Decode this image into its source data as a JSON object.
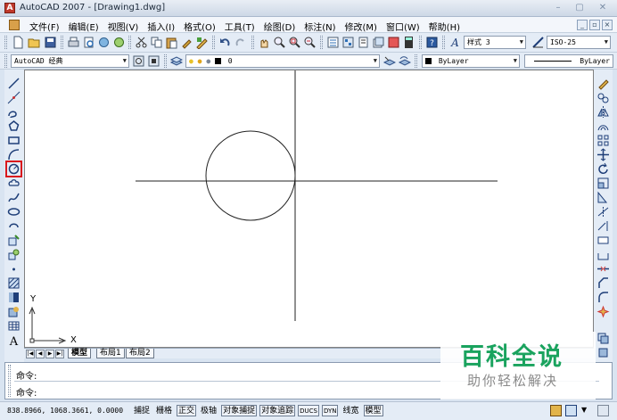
{
  "window": {
    "title": "AutoCAD 2007 - [Drawing1.dwg]",
    "controls": {
      "minimize": "–",
      "maximize": "▢",
      "close": "✕"
    }
  },
  "menubar": {
    "items": [
      "文件(F)",
      "编辑(E)",
      "视图(V)",
      "插入(I)",
      "格式(O)",
      "工具(T)",
      "绘图(D)",
      "标注(N)",
      "修改(M)",
      "窗口(W)",
      "帮助(H)"
    ],
    "doc_controls": {
      "minimize": "_",
      "restore": "▫",
      "close": "×"
    }
  },
  "toolbar_standard": {
    "icons": [
      "new-icon",
      "open-icon",
      "save-icon",
      "print-icon",
      "plot-preview-icon",
      "publish-icon",
      "3d-dwf-icon",
      "cut-icon",
      "copy-icon",
      "paste-icon",
      "match-properties-icon",
      "block-editor-icon",
      "undo-icon",
      "redo-icon",
      "pan-icon",
      "zoom-realtime-icon",
      "zoom-window-icon",
      "zoom-previous-icon",
      "properties-icon",
      "design-center-icon",
      "tool-palettes-icon",
      "sheet-set-icon",
      "markup-icon",
      "quickcalc-icon",
      "help-icon"
    ],
    "text_style_label": "样式 3",
    "dim_style_label": "ISO-25"
  },
  "toolbar_layers": {
    "workspace": "AutoCAD 经典",
    "layer_name": "0",
    "color": "ByLayer",
    "linetype": "ByLayer"
  },
  "left_toolbar": {
    "tools": [
      "line-icon",
      "construction-line-icon",
      "polyline-icon",
      "polygon-icon",
      "rectangle-icon",
      "arc-icon",
      "circle-icon",
      "revision-cloud-icon",
      "spline-icon",
      "ellipse-icon",
      "ellipse-arc-icon",
      "insert-block-icon",
      "make-block-icon",
      "point-icon",
      "hatch-icon",
      "gradient-icon",
      "region-icon",
      "table-icon",
      "multiline-text-icon"
    ],
    "active": "circle-icon",
    "text_tool_label": "A"
  },
  "right_toolbar": {
    "tools": [
      "erase-icon",
      "copy-object-icon",
      "mirror-icon",
      "offset-icon",
      "array-icon",
      "move-icon",
      "rotate-icon",
      "scale-icon",
      "stretch-icon",
      "trim-icon",
      "extend-icon",
      "break-at-point-icon",
      "break-icon",
      "join-icon",
      "chamfer-icon",
      "fillet-icon",
      "explode-icon"
    ]
  },
  "canvas": {
    "ucs_x_label": "X",
    "ucs_y_label": "Y"
  },
  "layout_tabs": {
    "nav": [
      "|◀",
      "◀",
      "▶",
      "▶|"
    ],
    "tabs": [
      "模型",
      "布局1",
      "布局2"
    ],
    "active": "模型"
  },
  "command_window": {
    "lines": [
      "命令:",
      "命令:"
    ]
  },
  "statusbar": {
    "coordinates": "838.8966,  1068.3661, 0.0000",
    "toggles": [
      {
        "label": "捕捉",
        "on": false
      },
      {
        "label": "栅格",
        "on": false
      },
      {
        "label": "正交",
        "on": true
      },
      {
        "label": "极轴",
        "on": false
      },
      {
        "label": "对象捕捉",
        "on": true
      },
      {
        "label": "对象追踪",
        "on": true
      },
      {
        "label": "DUCS",
        "on": true
      },
      {
        "label": "DYN",
        "on": true
      },
      {
        "label": "线宽",
        "on": false
      },
      {
        "label": "模型",
        "on": true
      }
    ]
  },
  "watermark": {
    "logo": "百科全说",
    "tagline": "助你轻松解决"
  },
  "colors": {
    "chrome": "#e4ecf6",
    "active_tool_outline": "#d9181d",
    "watermark_green": "#1aa35e"
  }
}
